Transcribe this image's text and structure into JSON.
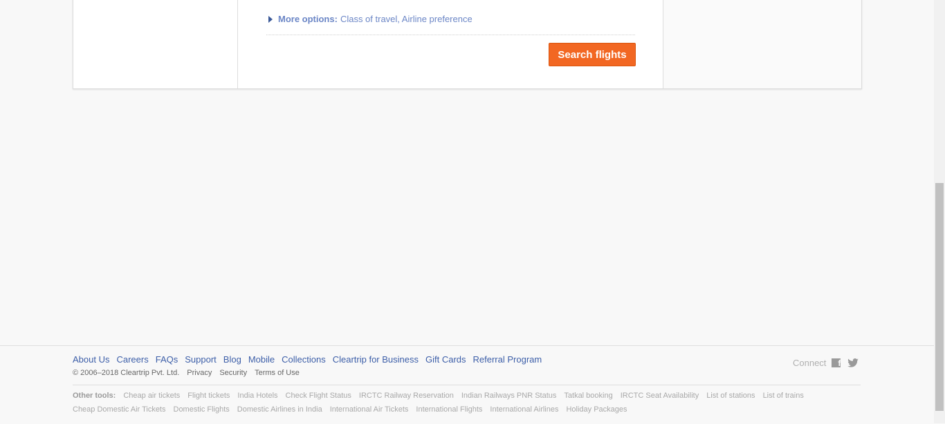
{
  "search_form": {
    "more_options_label": "More options:",
    "more_options_detail": "Class of travel, Airline preference",
    "search_button": "Search flights",
    "accent_color": "#f26722"
  },
  "footer": {
    "links": [
      "About Us",
      "Careers",
      "FAQs",
      "Support",
      "Blog",
      "Mobile",
      "Collections",
      "Cleartrip for Business",
      "Gift Cards",
      "Referral Program"
    ],
    "copyright": "© 2006–2018 Cleartrip Pvt. Ltd.",
    "legal_links": [
      "Privacy",
      "Security",
      "Terms of Use"
    ],
    "connect_label": "Connect",
    "social_icons": [
      "facebook-icon",
      "twitter-icon"
    ],
    "other_tools_label": "Other tools:",
    "tools_row1": [
      "Cheap air tickets",
      "Flight tickets",
      "India Hotels",
      "Check Flight Status",
      "IRCTC Railway Reservation",
      "Indian Railways PNR Status",
      "Tatkal booking",
      "IRCTC Seat Availability",
      "List of stations",
      "List of trains"
    ],
    "tools_row2": [
      "Cheap Domestic Air Tickets",
      "Domestic Flights",
      "Domestic Airlines in India",
      "International Air Tickets",
      "International Flights",
      "International Airlines",
      "Holiday Packages"
    ]
  }
}
